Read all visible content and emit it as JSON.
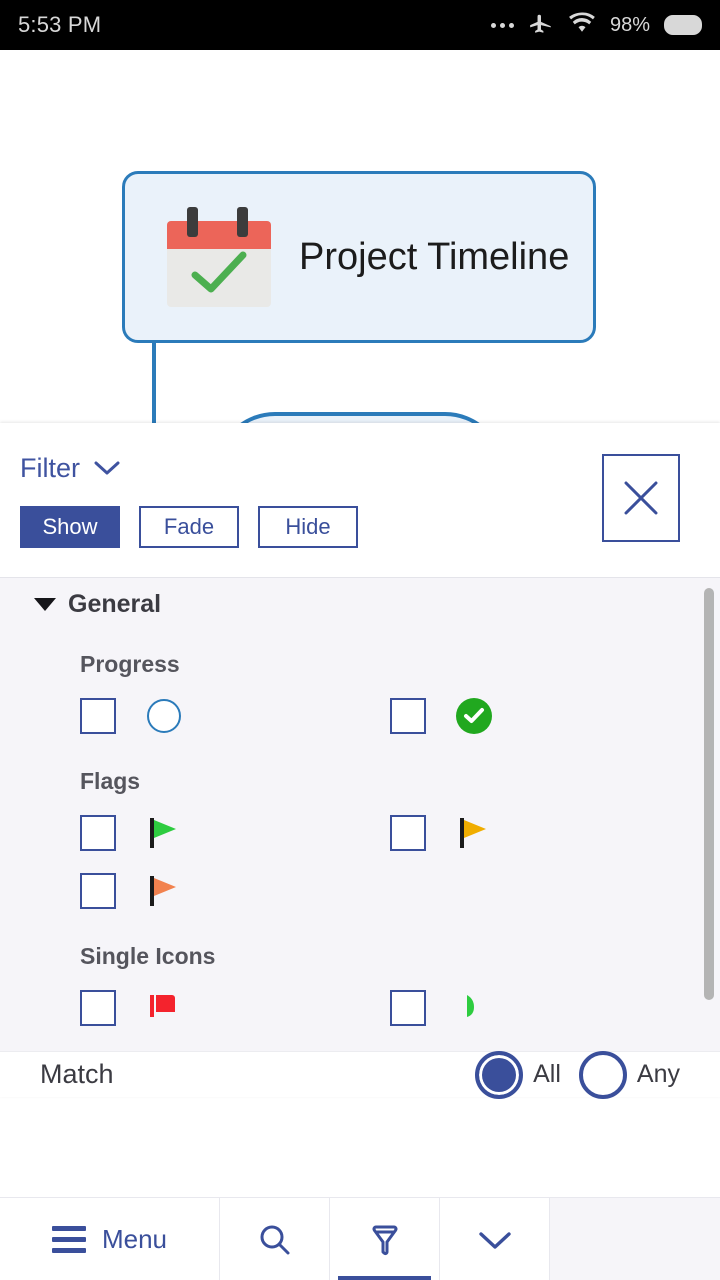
{
  "status_bar": {
    "time": "5:53 PM",
    "overflow_icon": "more-horizontal-icon",
    "airplane_icon": "airplane-mode-icon",
    "wifi_icon": "wifi-icon",
    "battery_percent": "98%",
    "battery_icon": "battery-full-icon"
  },
  "canvas": {
    "root_node": {
      "title": "Project Timeline",
      "icon": "calendar-check-icon",
      "border_color": "#2b7bba",
      "fill_color": "#eaf2fa"
    },
    "child_node": {
      "accent_color": "#59a7dd"
    }
  },
  "filter_panel": {
    "title": "Filter",
    "chevron_icon": "chevron-down-icon",
    "close_icon": "close-x-icon",
    "modes": [
      {
        "label": "Show",
        "selected": true
      },
      {
        "label": "Fade",
        "selected": false
      },
      {
        "label": "Hide",
        "selected": false
      }
    ],
    "accent_color": "#3a4f9b",
    "sections": [
      {
        "title": "General",
        "expanded": true,
        "groups": [
          {
            "title": "Progress",
            "rows": [
              [
                {
                  "checked": false,
                  "icon": "progress-empty-circle-icon",
                  "color": "#2b7bba"
                },
                {
                  "checked": false,
                  "icon": "progress-complete-check-icon",
                  "color": "#21a81f"
                }
              ]
            ]
          },
          {
            "title": "Flags",
            "rows": [
              [
                {
                  "checked": false,
                  "icon": "flag-green-icon",
                  "color": "#2ecc40"
                },
                {
                  "checked": false,
                  "icon": "flag-yellow-icon",
                  "color": "#f0ad00"
                }
              ],
              [
                {
                  "checked": false,
                  "icon": "flag-orange-icon",
                  "color": "#f2824f"
                }
              ]
            ]
          },
          {
            "title": "Single Icons",
            "rows": [
              [
                {
                  "checked": false,
                  "icon": "single-icon-red",
                  "color": "#f4232d"
                },
                {
                  "checked": false,
                  "icon": "single-icon-green",
                  "color": "#2ecc40"
                }
              ]
            ]
          }
        ]
      }
    ]
  },
  "match": {
    "label": "Match",
    "options": [
      {
        "label": "All",
        "selected": true
      },
      {
        "label": "Any",
        "selected": false
      }
    ]
  },
  "bottom_nav": {
    "menu_label": "Menu",
    "menu_icon": "hamburger-menu-icon",
    "items": [
      {
        "icon": "search-icon",
        "active": false
      },
      {
        "icon": "filter-funnel-icon",
        "active": true
      },
      {
        "icon": "chevron-down-icon",
        "active": false
      }
    ]
  }
}
